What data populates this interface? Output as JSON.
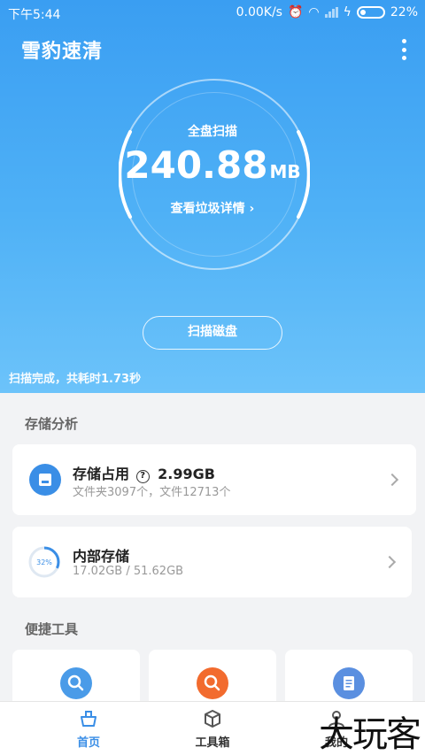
{
  "status_bar": {
    "time": "下午5:44",
    "net_speed": "0.00K/s",
    "battery": "22%"
  },
  "app": {
    "title": "雪豹速清"
  },
  "scan": {
    "label": "全盘扫描",
    "size_value": "240.88",
    "size_unit": "MB",
    "junk_link": "查看垃圾详情 ›",
    "button": "扫描磁盘",
    "result": "扫描完成，共耗时1.73秒"
  },
  "storage_section": {
    "title": "存储分析"
  },
  "storage_usage": {
    "title": "存储占用",
    "value": "2.99GB",
    "detail": "文件夹3097个，文件12713个"
  },
  "internal_storage": {
    "title": "内部存储",
    "percent": "32%",
    "percent_value": 0.32,
    "detail": "17.02GB / 51.62GB"
  },
  "tools_section": {
    "title": "便捷工具"
  },
  "tools": [
    {
      "icon": "search-icon",
      "color": "#4a9be8"
    },
    {
      "icon": "search-icon",
      "color": "#f26b2e"
    },
    {
      "icon": "document-icon",
      "color": "#5a8fe0"
    }
  ],
  "bottom_nav": {
    "home": "首页",
    "toolbox": "工具箱",
    "mine": "我的"
  },
  "watermark": "大玩客",
  "colors": {
    "accent": "#3a9ef2",
    "nav_active": "#3a8ee6"
  }
}
